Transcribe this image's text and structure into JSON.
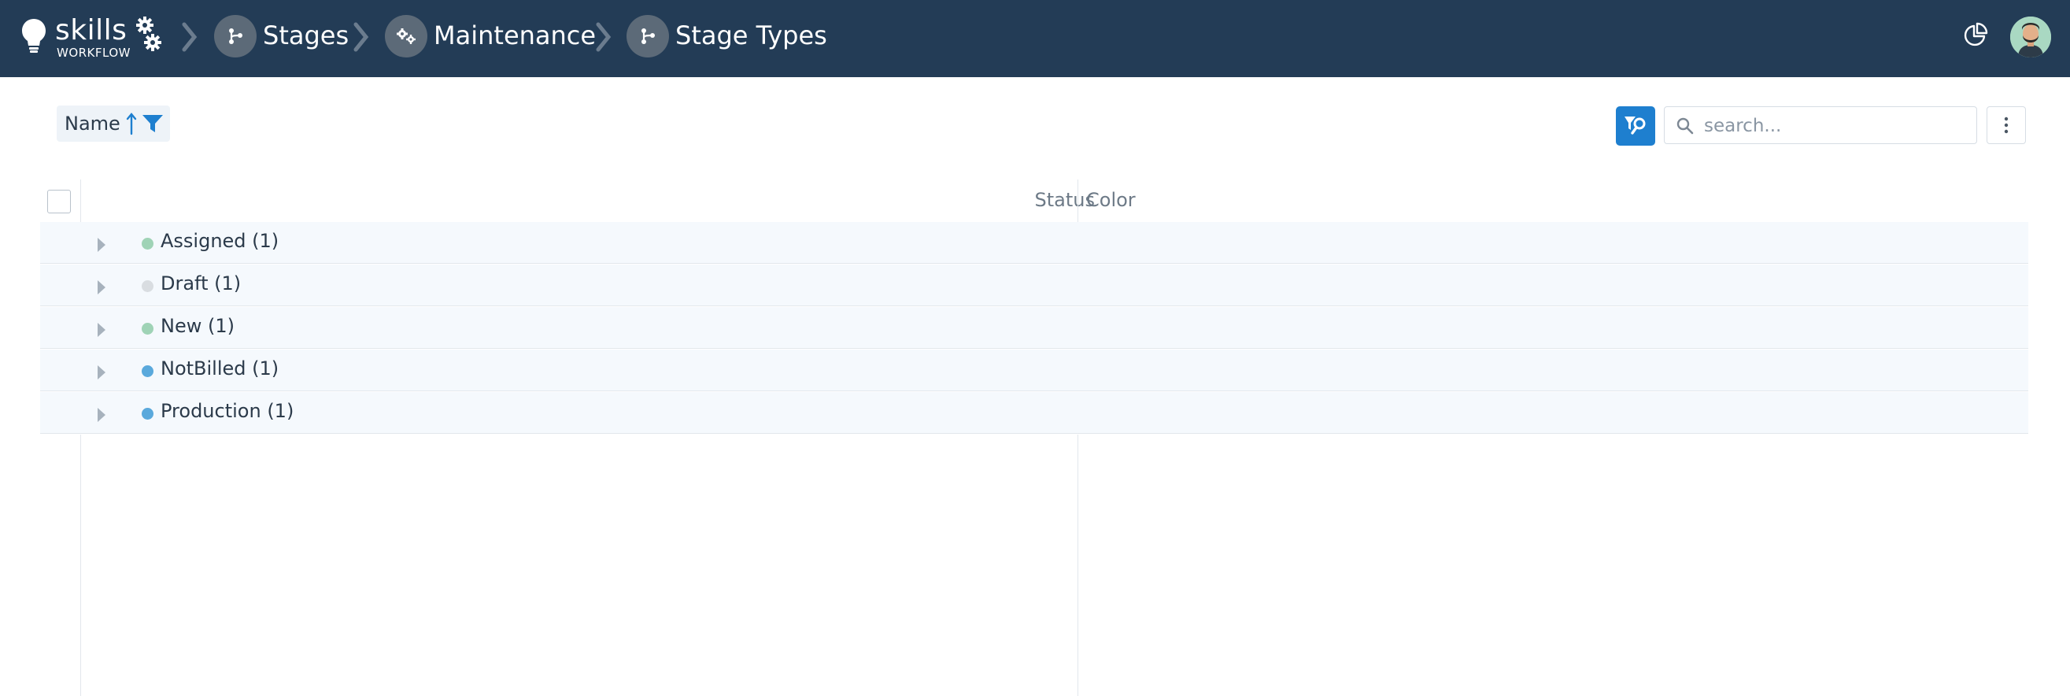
{
  "app": {
    "brand": "skills",
    "brand_sub": "WORKFLOW"
  },
  "breadcrumb": [
    {
      "label": "Stages",
      "icon": "branch-icon"
    },
    {
      "label": "Maintenance",
      "icon": "gears-icon"
    },
    {
      "label": "Stage Types",
      "icon": "branch-icon"
    }
  ],
  "header_actions": {
    "reports_icon": "pie-chart-icon",
    "avatar": "user-avatar"
  },
  "toolbar": {
    "sort_label": "Name",
    "sort_direction": "ascending",
    "search_placeholder": "search...",
    "search_value": ""
  },
  "grid": {
    "columns": [
      "Status",
      "Color"
    ],
    "groups": [
      {
        "label": "Assigned (1)",
        "color": "#9fd3b6"
      },
      {
        "label": "Draft (1)",
        "color": "#d9dde1"
      },
      {
        "label": "New (1)",
        "color": "#9fd3b6"
      },
      {
        "label": "NotBilled (1)",
        "color": "#5aa9dc"
      },
      {
        "label": "Production (1)",
        "color": "#5aa9dc"
      }
    ]
  },
  "colors": {
    "topbar": "#233c56",
    "accent": "#1e7fcf",
    "row_bg": "#f5f9fd"
  }
}
